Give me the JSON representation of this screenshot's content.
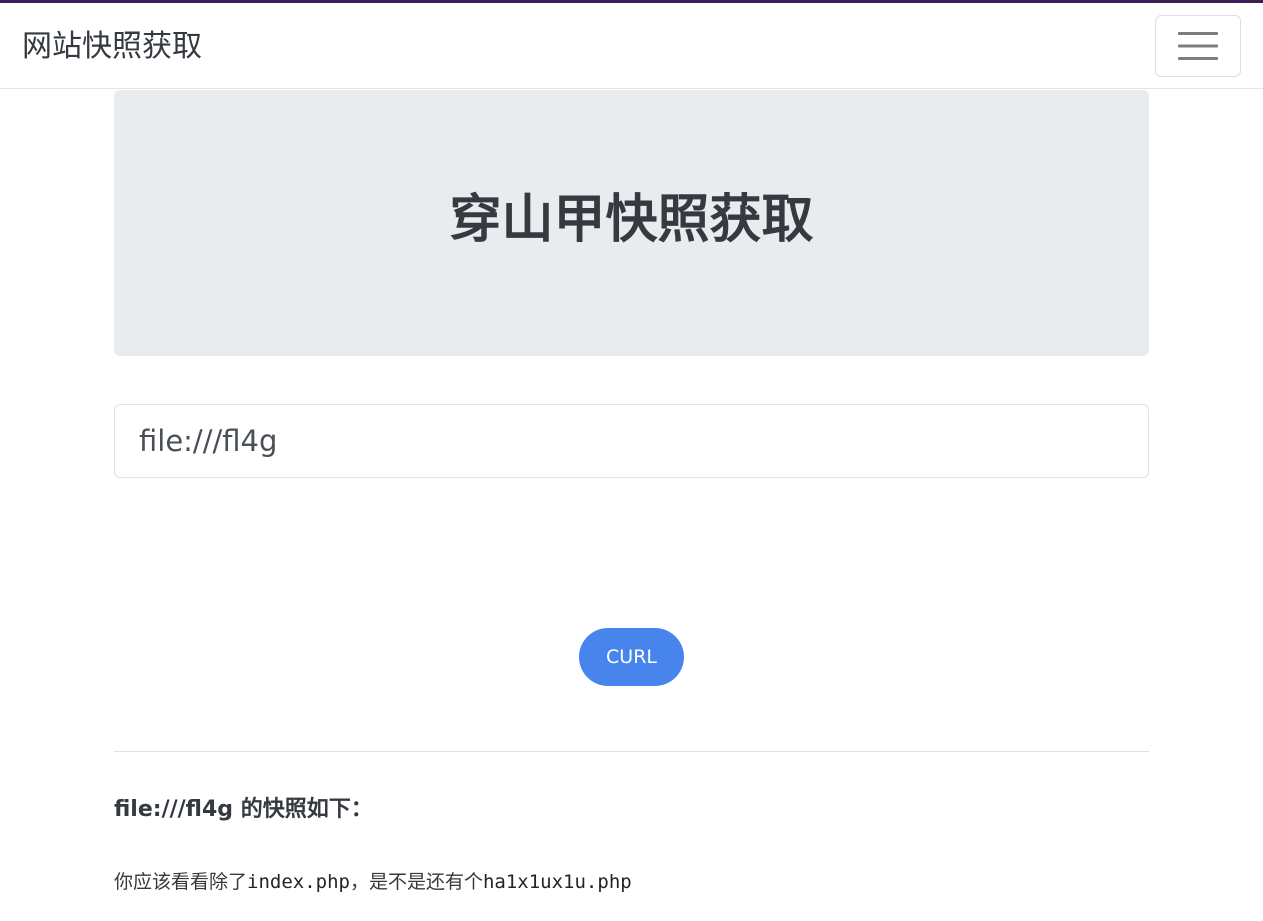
{
  "navbar": {
    "brand": "网站快照获取",
    "toggler_icon": "hamburger-menu-icon"
  },
  "jumbotron": {
    "title": "穿山甲快照获取"
  },
  "form": {
    "url_value": "file:///fl4g",
    "submit_label": "CURL"
  },
  "result": {
    "heading": "file:///fl4g 的快照如下：",
    "text_part1": "你应该看看除了",
    "code1": "index.php",
    "text_part2": "，是不是还有个",
    "code2": "ha1x1ux1u.php"
  },
  "colors": {
    "accent_bar": "#3b1f55",
    "button": "#4785ed",
    "jumbotron_bg": "#e9ecef"
  }
}
